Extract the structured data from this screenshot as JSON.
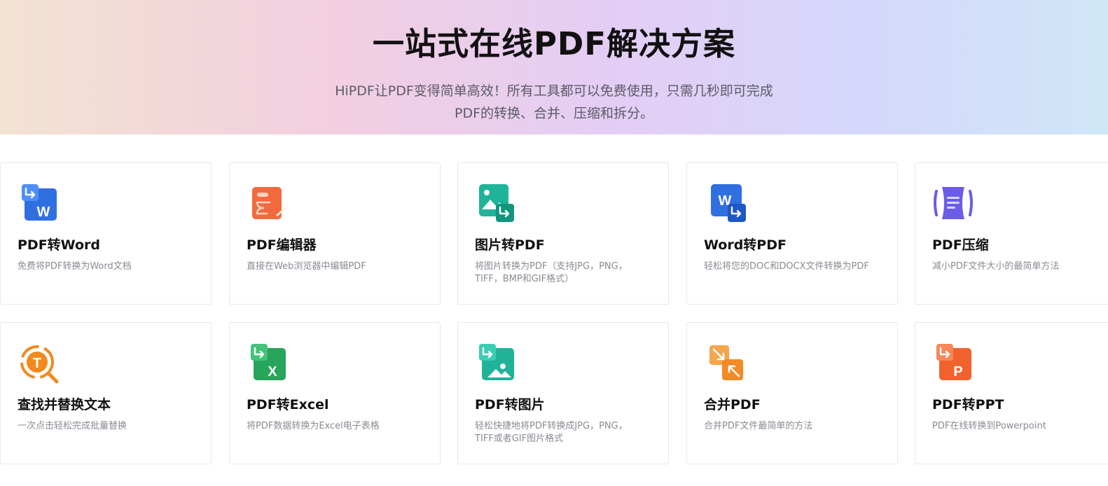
{
  "hero": {
    "title": "一站式在线PDF解决方案",
    "subtitle_line1": "HiPDF让PDF变得简单高效！所有工具都可以免费使用，只需几秒即可完成",
    "subtitle_line2": "PDF的转换、合并、压缩和拆分。"
  },
  "tools": [
    {
      "title": "PDF转Word",
      "desc": "免费将PDF转换为Word文档",
      "icon": "pdf-to-word-icon"
    },
    {
      "title": "PDF编辑器",
      "desc": "直接在Web浏览器中编辑PDF",
      "icon": "pdf-editor-icon"
    },
    {
      "title": "图片转PDF",
      "desc": "将图片转换为PDF（支持JPG，PNG，TIFF，BMP和GIF格式）",
      "icon": "image-to-pdf-icon"
    },
    {
      "title": "Word转PDF",
      "desc": "轻松将您的DOC和DOCX文件转换为PDF",
      "icon": "word-to-pdf-icon"
    },
    {
      "title": "PDF压缩",
      "desc": "减小PDF文件大小的最简单方法",
      "icon": "compress-pdf-icon"
    },
    {
      "title": "查找并替换文本",
      "desc": "一次点击轻松完成批量替换",
      "icon": "find-replace-icon"
    },
    {
      "title": "PDF转Excel",
      "desc": "将PDF数据转换为Excel电子表格",
      "icon": "pdf-to-excel-icon"
    },
    {
      "title": "PDF转图片",
      "desc": "轻松快捷地将PDF转换成JPG，PNG，TIFF或者GIF图片格式",
      "icon": "pdf-to-image-icon"
    },
    {
      "title": "合并PDF",
      "desc": "合并PDF文件最简单的方法",
      "icon": "merge-pdf-icon"
    },
    {
      "title": "PDF转PPT",
      "desc": "PDF在线转换到Powerpoint",
      "icon": "pdf-to-ppt-icon"
    }
  ],
  "colors": {
    "word_blue": "#2f6fe0",
    "editor_orange": "#f26a3d",
    "image_teal": "#1fb39a",
    "compress_purple": "#6b5ce7",
    "find_orange": "#f08a1c",
    "excel_green": "#27a55a",
    "merge_orange": "#f28a26",
    "ppt_orange": "#f2622e"
  }
}
